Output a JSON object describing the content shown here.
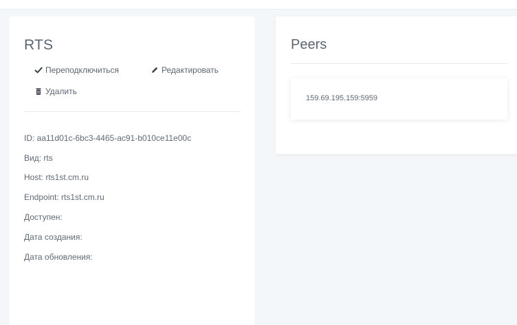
{
  "rts_card": {
    "title": "RTS",
    "actions": {
      "reconnect_label": "Переподключиться",
      "edit_label": "Редактировать",
      "delete_label": "Удалить"
    },
    "info": {
      "id": "ID: aa11d01c-6bc3-4465-ac91-b010ce11e00c",
      "kind": "Вид: rts",
      "host": "Host: rts1st.cm.ru",
      "endpoint": "Endpoint: rts1st.cm.ru",
      "available": "Доступен:",
      "created": "Дата создания:",
      "updated": "Дата обновления:"
    }
  },
  "peers_card": {
    "title": "Peers",
    "items": [
      {
        "address": "159.69.195.159:5959"
      }
    ]
  },
  "icons": {
    "reconnect": "check-icon",
    "edit": "pencil-icon",
    "delete": "trash-icon"
  }
}
